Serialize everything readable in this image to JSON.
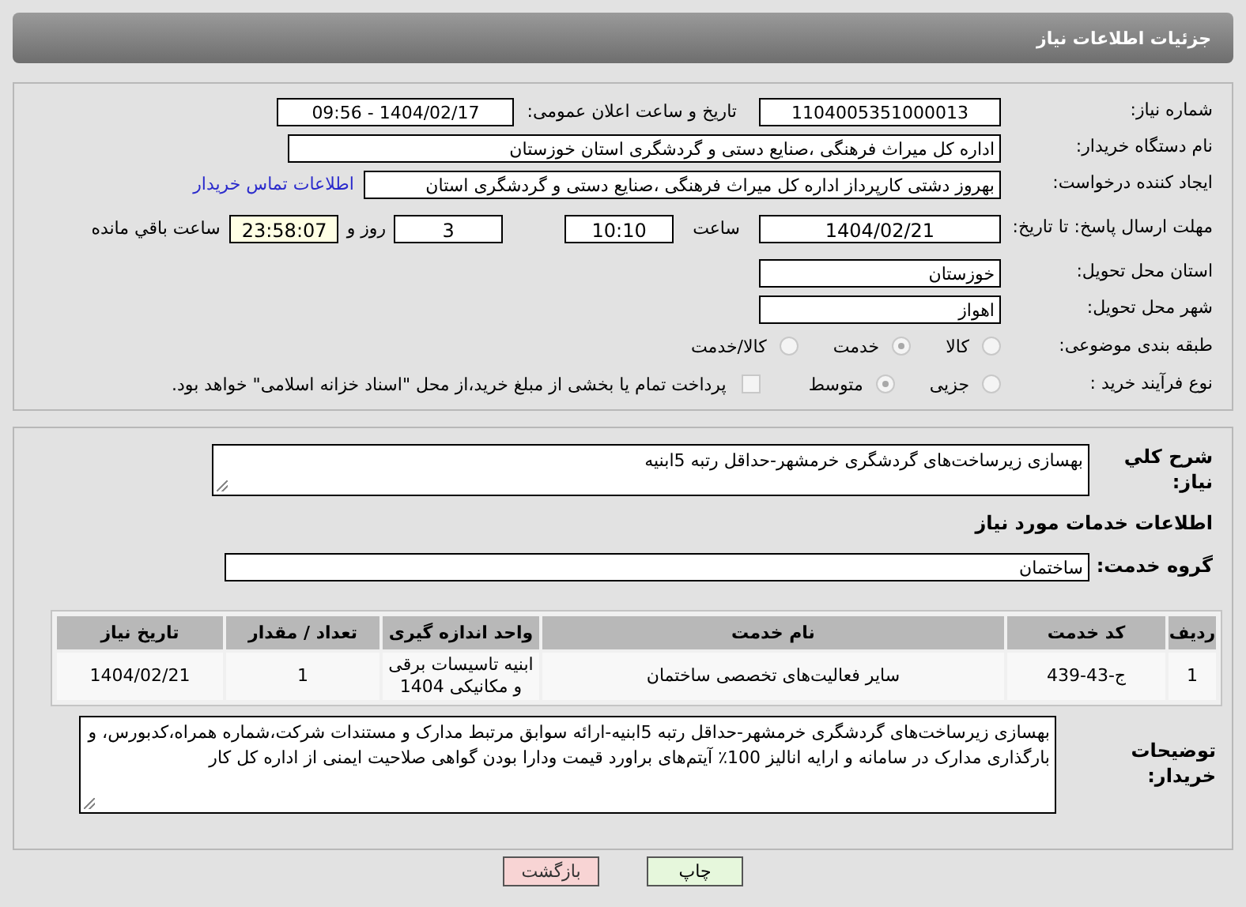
{
  "header": {
    "title": "جزئیات اطلاعات نیاز"
  },
  "need_number": {
    "label": "شماره نیاز:",
    "value": "1104005351000013"
  },
  "announce": {
    "label": "تاریخ و ساعت اعلان عمومی:",
    "value": "1404/02/17 - 09:56"
  },
  "buyer": {
    "label": "نام دستگاه خریدار:",
    "value": "اداره کل میراث فرهنگی ،صنایع دستی و گردشگری استان خوزستان"
  },
  "creator": {
    "label": "ایجاد کننده درخواست:",
    "value": "بهروز دشتی کارپرداز اداره کل میراث فرهنگی ،صنایع دستی و گردشگری استان",
    "link": "اطلاعات تماس خریدار"
  },
  "deadline": {
    "label": "مهلت ارسال پاسخ: تا تاریخ:",
    "date": "1404/02/21",
    "time_label": "ساعت",
    "time": "10:10",
    "days": "3",
    "days_label": "روز و",
    "remaining": "23:58:07",
    "remaining_label": "ساعت باقي مانده"
  },
  "province": {
    "label": "استان محل تحویل:",
    "value": "خوزستان"
  },
  "city": {
    "label": "شهر محل تحویل:",
    "value": "اهواز"
  },
  "category": {
    "label": "طبقه بندی موضوعی:",
    "options": [
      {
        "label": "کالا",
        "selected": false
      },
      {
        "label": "خدمت",
        "selected": true
      },
      {
        "label": "کالا/خدمت",
        "selected": false
      }
    ]
  },
  "process": {
    "label": "نوع فرآیند خرید :",
    "options": [
      {
        "label": "جزیی",
        "selected": false
      },
      {
        "label": "متوسط",
        "selected": true
      }
    ],
    "treasury": {
      "label": "پرداخت تمام یا بخشی از مبلغ خرید،از محل \"اسناد خزانه اسلامی\" خواهد بود.",
      "checked": false
    }
  },
  "description": {
    "label": "شرح کلي نياز:",
    "value": "بهسازی زیرساخت‌های گردشگری خرمشهر-حداقل رتبه 5ابنیه"
  },
  "services_heading": "اطلاعات خدمات مورد نياز",
  "service_group": {
    "label": "گروه خدمت:",
    "value": "ساختمان"
  },
  "table": {
    "columns": [
      "ردیف",
      "کد خدمت",
      "نام خدمت",
      "واحد اندازه گیری",
      "تعداد / مقدار",
      "تاریخ نیاز"
    ],
    "rows": [
      [
        "1",
        "ج-43-439",
        "سایر فعالیت‌های تخصصی ساختمان",
        "ابنیه تاسیسات برقی و مکانیکی 1404",
        "1",
        "1404/02/21"
      ]
    ]
  },
  "buyer_notes": {
    "label": "توضیحات خریدار:",
    "value": "بهسازی زیرساخت‌های گردشگری خرمشهر-حداقل رتبه 5ابنیه-ارائه سوابق مرتبط مدارک و مستندات شرکت،شماره همراه،کدبورس، و بارگذاری مدارک در سامانه و ارایه انالیز 100٪ آیتم‌های براورد قیمت ودارا بودن گواهی صلاحیت ایمنی از اداره کل کار"
  },
  "buttons": [
    {
      "label": "چاپ",
      "kind": "print"
    },
    {
      "label": "بازگشت",
      "kind": "back"
    }
  ]
}
